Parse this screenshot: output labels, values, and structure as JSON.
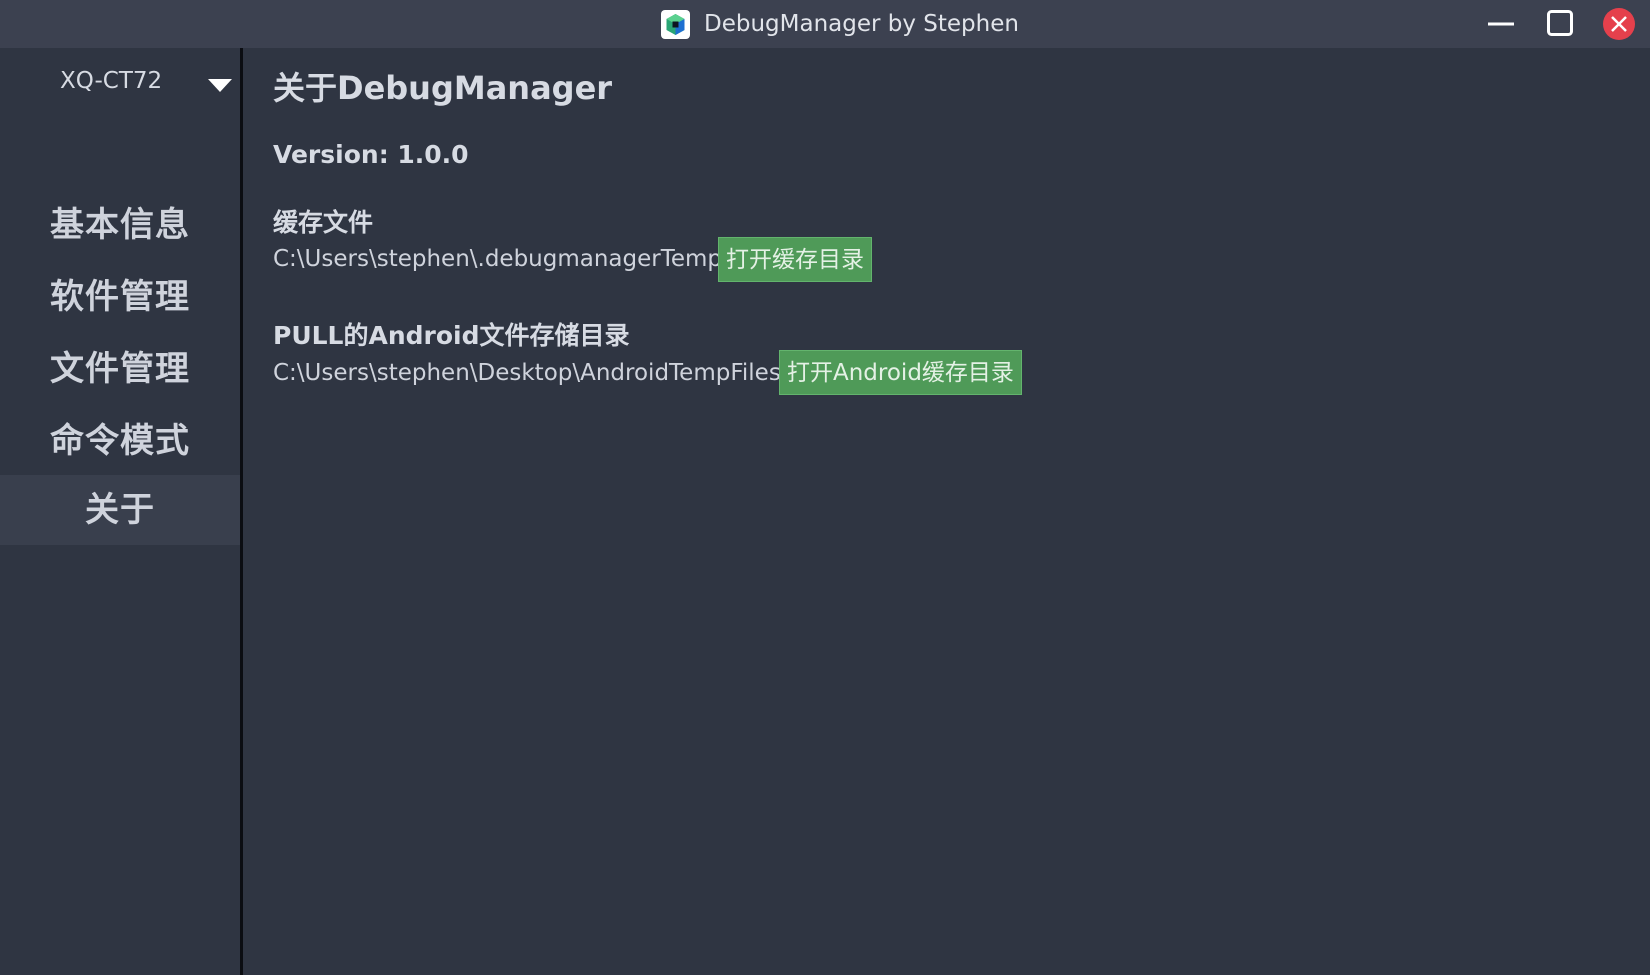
{
  "window": {
    "title": "DebugManager by Stephen"
  },
  "icons": {
    "app": "app-logo-icon",
    "minimize": "minimize-icon",
    "maximize": "maximize-icon",
    "close": "close-icon",
    "dropdown": "chevron-down-icon"
  },
  "colors": {
    "background": "#2f3542",
    "titlebar": "#3c4150",
    "active_nav": "#393f4d",
    "button_green": "#4f9a58",
    "close_red": "#e5404c"
  },
  "sidebar": {
    "device": "XQ-CT72",
    "items": [
      {
        "label": "基本信息"
      },
      {
        "label": "软件管理"
      },
      {
        "label": "文件管理"
      },
      {
        "label": "命令模式"
      },
      {
        "label": "关于"
      }
    ],
    "active_index": 4
  },
  "main": {
    "title": "关于DebugManager",
    "version": "Version: 1.0.0",
    "cache": {
      "label": "缓存文件",
      "path": "C:\\Users\\stephen\\.debugmanagerTemp",
      "button": "打开缓存目录"
    },
    "android": {
      "label": "PULL的Android文件存储目录",
      "path": "C:\\Users\\stephen\\Desktop\\AndroidTempFiles",
      "button": "打开Android缓存目录"
    }
  }
}
